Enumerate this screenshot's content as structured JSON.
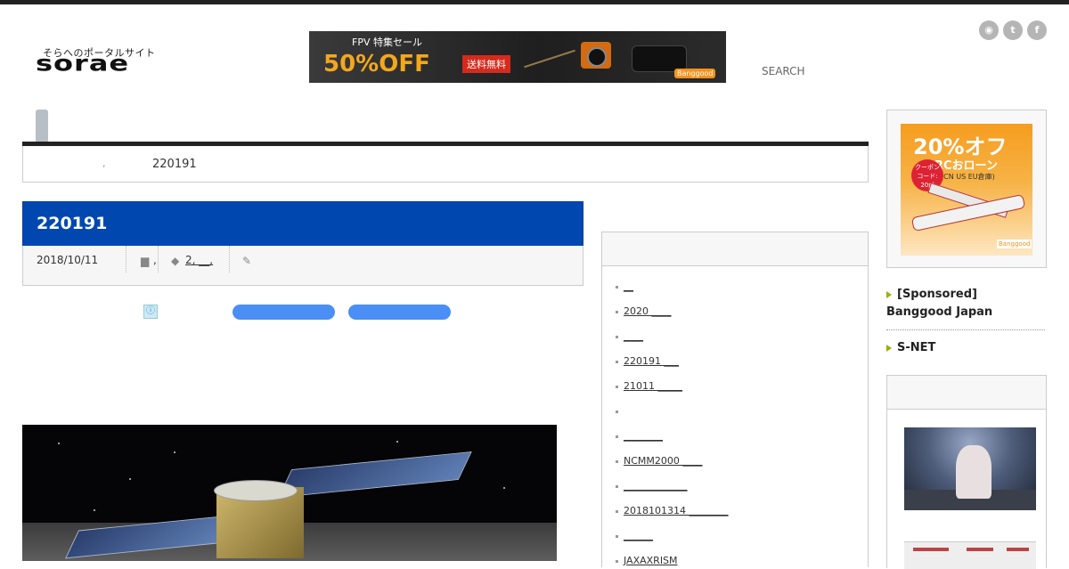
{
  "header": {
    "logo_tagline": "そらへのポータルサイト",
    "logo_text": "sorae",
    "search_label": "SEARCH",
    "banner_ad": {
      "top_text": "FPV 特集セール",
      "big_text": "50%OFF",
      "badge_text": "送料無料",
      "brand": "Banggood"
    },
    "social_icons": [
      "rss-icon",
      "twitter-icon",
      "facebook-icon"
    ],
    "social_glyphs": [
      "◉",
      "t",
      "f"
    ]
  },
  "breadcrumb": {
    "separator": ",",
    "current": "220191"
  },
  "post": {
    "title": "220191",
    "date": "2018/10/11",
    "category_text": ",",
    "tags_text": "2, __,",
    "file_glyph": "▆",
    "tag_glyph": "◆",
    "edit_glyph": "✎"
  },
  "ad_slot": {
    "info_glyph": "ⓘ"
  },
  "sidebar": {
    "items": [
      "__",
      "2020 ____",
      "____",
      "220191 ___",
      "21011 _____",
      "",
      "________",
      "NCMM2000 ____",
      "_____________",
      "2018101314 ________",
      "______",
      "JAXAXRISM"
    ]
  },
  "right_column": {
    "ad": {
      "big_text": "20%オフ",
      "sub_text": "RCおローン",
      "sub_text2": "(CN US EU倉庫)",
      "coupon_text": "クーポン コード: 20pl",
      "brand": "Banggood"
    },
    "links": [
      "[Sponsored] Banggood Japan",
      "S-NET"
    ]
  },
  "colors": {
    "title_bar": "#0048b0",
    "link_marker": "#9ab000",
    "ad_pill": "#4a8ef6",
    "top_bar": "#222222"
  }
}
